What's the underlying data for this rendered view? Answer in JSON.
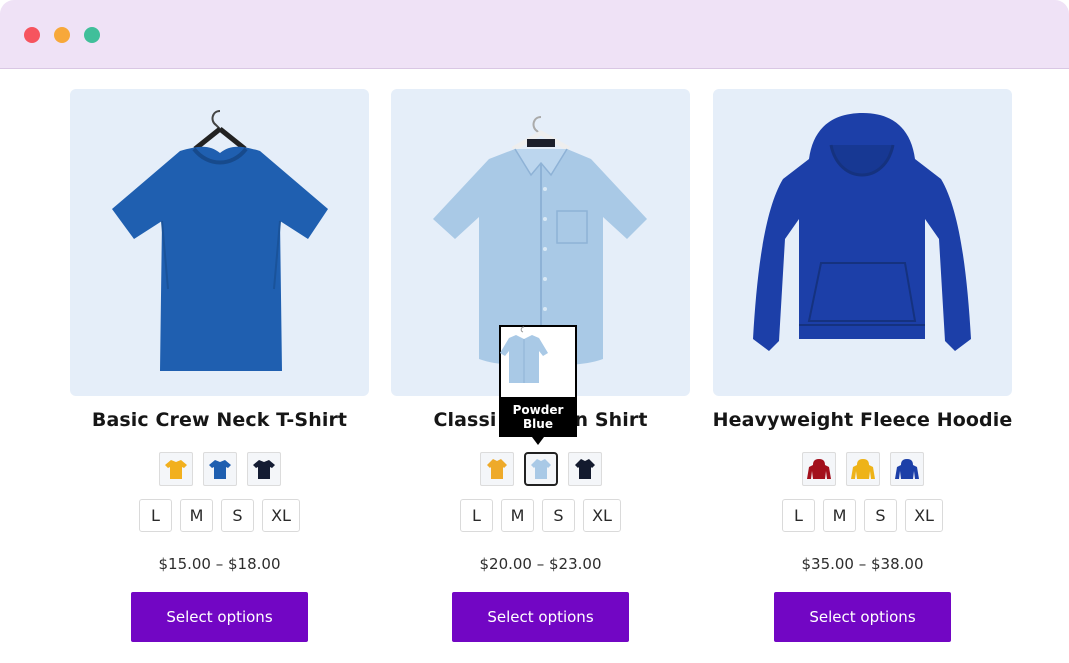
{
  "window": {
    "controls": [
      "close",
      "minimize",
      "maximize"
    ]
  },
  "products": [
    {
      "title": "Basic Crew Neck T-Shirt",
      "image": "blue-tshirt",
      "colors": [
        {
          "name": "yellow-tshirt-swatch",
          "hex": "#f2b01e"
        },
        {
          "name": "blue-tshirt-swatch",
          "hex": "#1f5fb0"
        },
        {
          "name": "navy-tshirt-swatch",
          "hex": "#141c33"
        }
      ],
      "sizes": [
        "L",
        "M",
        "S",
        "XL"
      ],
      "price": "$15.00 – $18.00",
      "button": "Select options"
    },
    {
      "title": "Classic Button Shirt",
      "title_visible_left": "Classi",
      "title_visible_right": "n Shirt",
      "image": "powder-blue-shirt",
      "colors": [
        {
          "name": "yellow-shirt-swatch",
          "hex": "#eeaa2a"
        },
        {
          "name": "powder-blue-shirt-swatch",
          "hex": "#a9c9e6"
        },
        {
          "name": "navy-shirt-swatch",
          "hex": "#131a2e"
        }
      ],
      "active_color": 1,
      "tooltip": {
        "line1": "Powder",
        "line2": "Blue"
      },
      "sizes": [
        "L",
        "M",
        "S",
        "XL"
      ],
      "price": "$20.00 – $23.00",
      "button": "Select options"
    },
    {
      "title": "Heavyweight Fleece Hoodie",
      "image": "royal-blue-hoodie",
      "colors": [
        {
          "name": "red-hoodie-swatch",
          "hex": "#a3101c"
        },
        {
          "name": "yellow-hoodie-swatch",
          "hex": "#eeb318"
        },
        {
          "name": "blue-hoodie-swatch",
          "hex": "#1c3fa8"
        }
      ],
      "sizes": [
        "L",
        "M",
        "S",
        "XL"
      ],
      "price": "$35.00 – $38.00",
      "button": "Select options"
    }
  ],
  "colors": {
    "accent": "#7206c4",
    "window_bar": "#efe2f6",
    "image_bg": "#e5eef9"
  }
}
